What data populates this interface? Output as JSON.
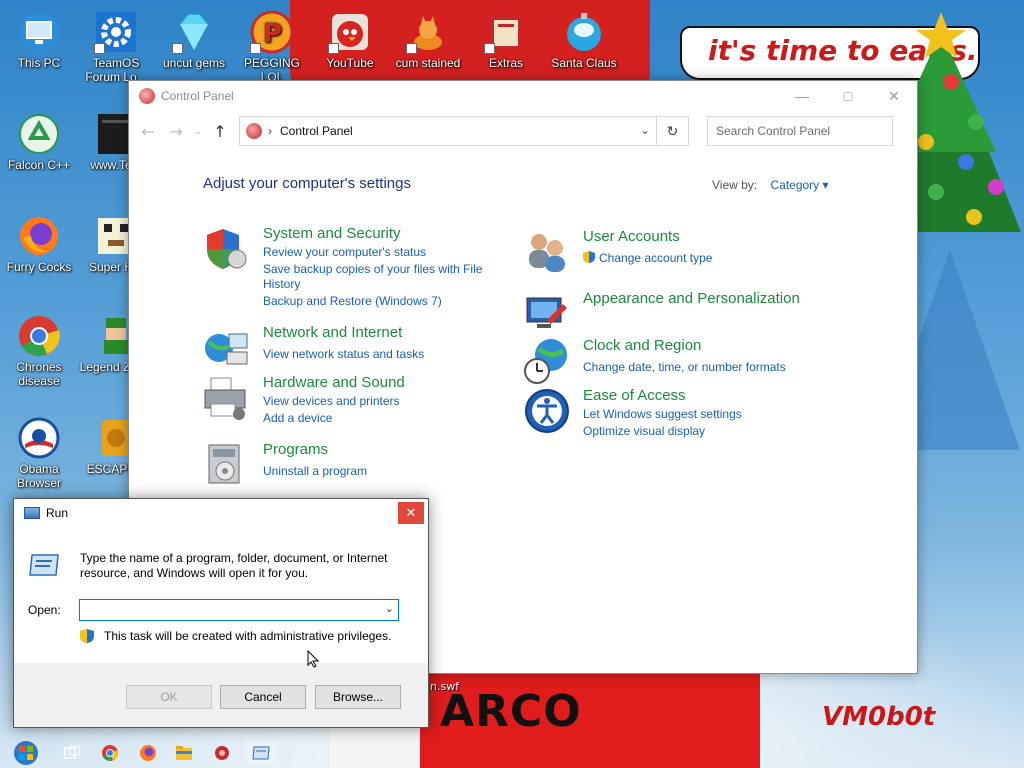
{
  "desktop": {
    "icons": [
      {
        "label": "This PC",
        "icon": "monitor-icon"
      },
      {
        "label": "TeamOS Forum Lo...",
        "icon": "gear-icon"
      },
      {
        "label": "uncut gems",
        "icon": "diamond-icon"
      },
      {
        "label": "PEGGING LOL",
        "icon": "p-logo-icon"
      },
      {
        "label": "YouTube",
        "icon": "angry-bird-icon"
      },
      {
        "label": "cum stained",
        "icon": "cat-icon"
      },
      {
        "label": "Extras",
        "icon": "folder-icon"
      },
      {
        "label": "Santa Claus",
        "icon": "ornament-icon"
      },
      {
        "label": "Falcon C++",
        "icon": "recycle-icon"
      },
      {
        "label": "www.Te...",
        "icon": "shortcut-icon"
      },
      {
        "label": "Furry Cocks",
        "icon": "firefox-icon"
      },
      {
        "label": "Super H...",
        "icon": "pixel-art-icon"
      },
      {
        "label": "Chrones disease",
        "icon": "chrome-icon"
      },
      {
        "label": "Legend Zild...",
        "icon": "pixel-character-icon"
      },
      {
        "label": "Obama Browser",
        "icon": "obama-logo-icon"
      },
      {
        "label": "ESCAPE...",
        "icon": "coin-icon"
      }
    ],
    "wallpaper_caption": "it's time to eat s..t",
    "wallpaper_text_bottom": "ARCO",
    "wallpaper_file": "n.swf",
    "wallpaper_signature": "VM0b0t"
  },
  "control_panel": {
    "window_title": "Control Panel",
    "address": "Control Panel",
    "search_placeholder": "Search Control Panel",
    "heading": "Adjust your computer's settings",
    "view_by_label": "View by:",
    "view_by_value": "Category",
    "categories_left": [
      {
        "title": "System and Security",
        "icon": "shield-icon",
        "links": [
          "Review your computer's status",
          "Save backup copies of your files with File History",
          "Backup and Restore (Windows 7)"
        ]
      },
      {
        "title": "Network and Internet",
        "icon": "network-icon",
        "links": [
          "View network status and tasks"
        ]
      },
      {
        "title": "Hardware and Sound",
        "icon": "printer-icon",
        "links": [
          "View devices and printers",
          "Add a device"
        ]
      },
      {
        "title": "Programs",
        "icon": "programs-icon",
        "links": [
          "Uninstall a program"
        ]
      }
    ],
    "categories_right": [
      {
        "title": "User Accounts",
        "icon": "users-icon",
        "links": [
          "Change account type"
        ]
      },
      {
        "title": "Appearance and Personalization",
        "icon": "appearance-icon",
        "links": []
      },
      {
        "title": "Clock and Region",
        "icon": "clock-globe-icon",
        "links": [
          "Change date, time, or number formats"
        ]
      },
      {
        "title": "Ease of Access",
        "icon": "ease-of-access-icon",
        "links": [
          "Let Windows suggest settings",
          "Optimize visual display"
        ]
      }
    ]
  },
  "run_dialog": {
    "title": "Run",
    "description": "Type the name of a program, folder, document, or Internet resource, and Windows will open it for you.",
    "open_label": "Open:",
    "open_value": "",
    "admin_note": "This task will be created with administrative privileges.",
    "ok_label": "OK",
    "cancel_label": "Cancel",
    "browse_label": "Browse..."
  },
  "taskbar": {
    "items": [
      "start-button",
      "task-view-icon",
      "chrome-icon",
      "firefox-icon",
      "file-explorer-icon",
      "control-panel-icon",
      "run-icon"
    ]
  },
  "colors": {
    "heading_blue": "#1e3287",
    "category_green": "#1d8a3b",
    "link_blue": "#1a5fb4",
    "close_red": "#e0483b"
  }
}
